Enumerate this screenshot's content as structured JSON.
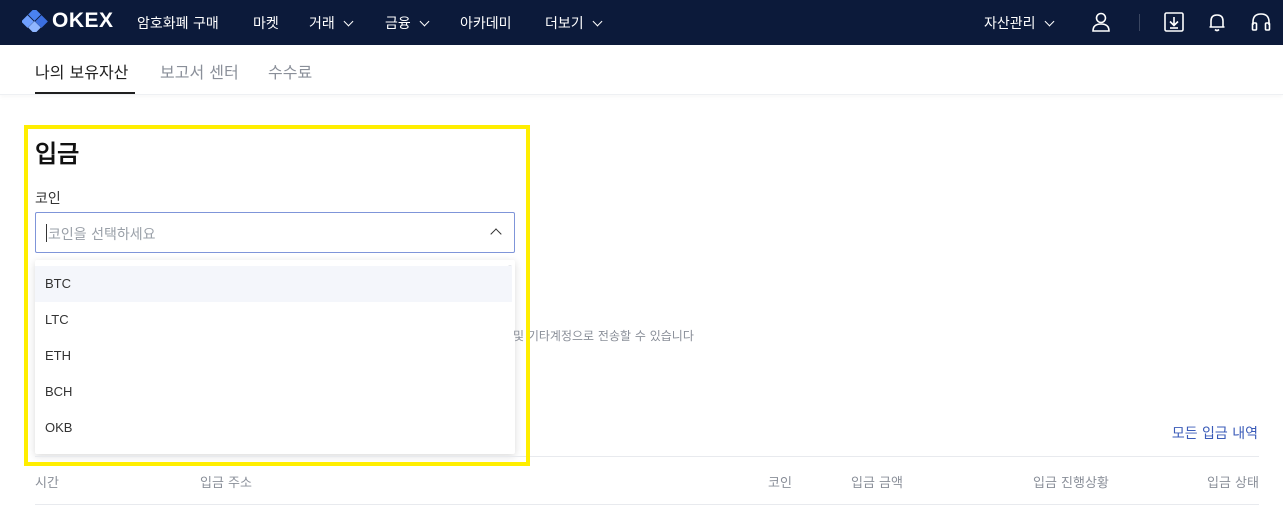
{
  "nav": {
    "logo_text": "OKEX",
    "items": [
      {
        "label": "암호화폐 구매"
      },
      {
        "label": "마켓"
      },
      {
        "label": "거래"
      },
      {
        "label": "금융"
      },
      {
        "label": "아카데미"
      },
      {
        "label": "더보기"
      }
    ],
    "asset_management": "자산관리"
  },
  "subnav": {
    "tabs": [
      {
        "label": "나의 보유자산"
      },
      {
        "label": "보고서 센터"
      },
      {
        "label": "수수료"
      }
    ]
  },
  "deposit": {
    "title": "입금",
    "coin_label": "코인",
    "coin_placeholder": "코인을 선택하세요",
    "options": [
      "BTC",
      "LTC",
      "ETH",
      "BCH",
      "OKB"
    ]
  },
  "partial_note": "및 기타계정으로 전송할 수 있습니다",
  "history": {
    "link": "모든 입금 내역",
    "columns": [
      "시간",
      "입금 주소",
      "코인",
      "입금 금액",
      "입금 진행상황",
      "입금 상태"
    ]
  },
  "colors": {
    "nav_bg": "#0c1a3a",
    "accent_blue": "#3a5bb8",
    "highlight": "#ffee00"
  }
}
